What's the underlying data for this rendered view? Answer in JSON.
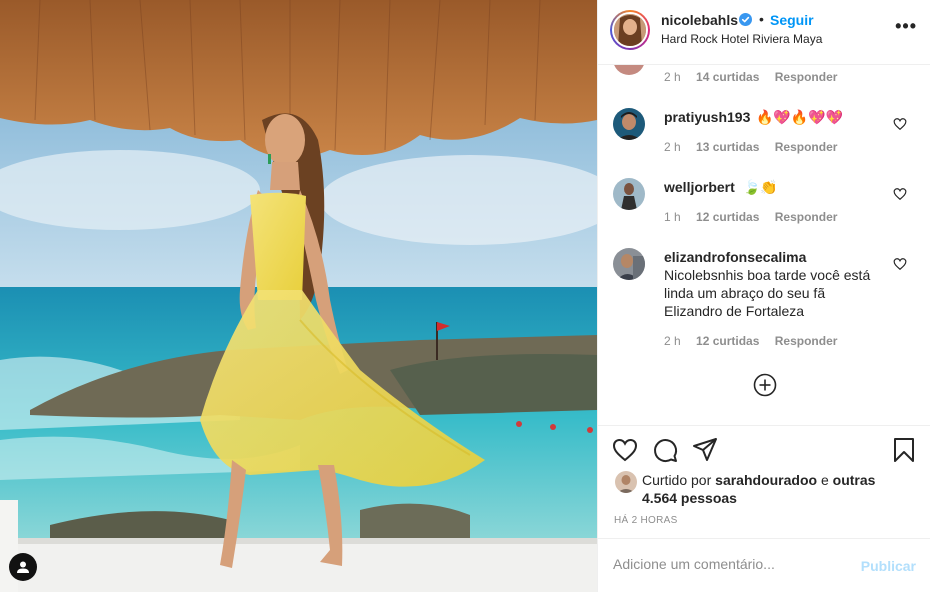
{
  "post": {
    "author": "nicolebahls",
    "verified": true,
    "follow_label": "Seguir",
    "separator": "•",
    "location": "Hard Rock Hotel Riviera Maya",
    "more_label": "•••"
  },
  "comments": [
    {
      "username": "",
      "text": "",
      "time": "2 h",
      "likes": "14 curtidas",
      "reply": "Responder"
    },
    {
      "username": "pratiyush193",
      "text": "🔥💖🔥💖💖",
      "time": "2 h",
      "likes": "13 curtidas",
      "reply": "Responder"
    },
    {
      "username": "welljorbert",
      "text": "🍃👏",
      "time": "1 h",
      "likes": "12 curtidas",
      "reply": "Responder"
    },
    {
      "username": "elizandrofonsecalima",
      "text": "Nicolebsnhis boa tarde você está linda um abraço do seu fã Elizandro de Fortaleza",
      "time": "2 h",
      "likes": "12 curtidas",
      "reply": "Responder"
    }
  ],
  "likes": {
    "prefix": "Curtido por",
    "user": "sarahdouradoo",
    "conj": "e",
    "others": "outras 4.564 pessoas"
  },
  "timestamp": "HÁ 2 HORAS",
  "add_comment": {
    "placeholder": "Adicione um comentário...",
    "publish_label": "Publicar"
  },
  "colors": {
    "accent": "#0095f6",
    "publish_disabled": "#b2dffc",
    "secondary_text": "#8e8e8e",
    "border": "#efefef"
  },
  "icons": [
    "user-tag-icon",
    "verified-icon",
    "more-icon",
    "heart-icon",
    "comment-icon",
    "share-icon",
    "bookmark-icon",
    "plus-circle-icon"
  ]
}
